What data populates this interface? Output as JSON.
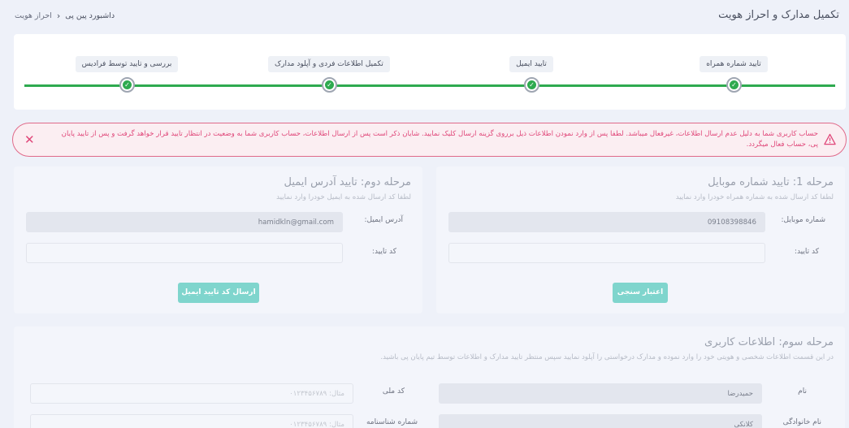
{
  "header": {
    "page_title": "تکمیل مدارک و احراز هویت",
    "breadcrumb": {
      "home": "داشبورد پین پی",
      "current": "احراز هویت"
    }
  },
  "steps": [
    {
      "label": "تایید شماره همراه",
      "done": true
    },
    {
      "label": "تایید ایمیل",
      "done": true
    },
    {
      "label": "تکمیل اطلاعات فردی و آپلود مدارک",
      "done": true
    },
    {
      "label": "بررسی و تایید توسط فرادیس",
      "done": true
    }
  ],
  "alert": {
    "text": "حساب کاربری شما به دلیل عدم ارسال اطلاعات، غیرفعال میباشد. لطفا پس از وارد نمودن اطلاعات ذیل برروی گزینه ارسال کلیک نمایید. شایان ذکر است پس از ارسال اطلاعات، حساب کاربری شما به وضعیت در انتظار تایید قرار خواهد گرفت و پس از تایید پایان پی، حساب فعال میگردد.",
    "icon": "warning-icon",
    "color": "#e0487a"
  },
  "mobile_card": {
    "title": "مرحله 1: تایید شماره موبایل",
    "subtitle": "لطفا کد ارسال شده به شماره همراه خودرا وارد نمایید",
    "mobile_label": "شماره موبایل:",
    "mobile_value": "09108398846",
    "code_label": "کد تایید:",
    "code_value": "",
    "button": "اعتبار سنجی"
  },
  "email_card": {
    "title": "مرحله دوم: تایید آدرس ایمیل",
    "subtitle": "لطفا کد ارسال شده به ایمیل خودرا وارد نمایید",
    "email_label": "آدرس ایمیل:",
    "email_value": "hamidkln@gmail.com",
    "code_label": "کد تایید:",
    "code_value": "",
    "button": "ارسال کد تایید ایمیل"
  },
  "user_card": {
    "title": "مرحله سوم: اطلاعات کاربری",
    "subtitle": "در این قسمت اطلاعات شخصی و هویتی خود را وارد نموده و مدارک درخواستی را آپلود نمایید سپس منتظر تایید مدارک و اطلاعات توسط تیم پایان پی باشید.",
    "name_label": "نام",
    "name_value": "حمیدرضا",
    "national_id_label": "کد ملی",
    "national_id_placeholder": "مثال: ۰۱۲۳۴۵۶۷۸۹",
    "family_label": "نام خانوادگی",
    "family_value": "کلانکی",
    "id_number_label": "شماره شناسنامه",
    "id_number_placeholder": "مثال: ۰۱۲۳۴۵۶۷۸۹"
  },
  "colors": {
    "accent_green": "#2eaa4f",
    "button_teal": "#7fd5cd",
    "alert_pink": "#e0487a"
  }
}
